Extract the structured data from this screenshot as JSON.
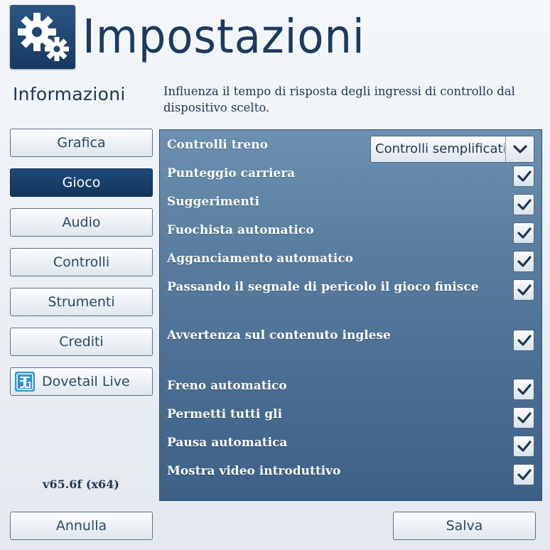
{
  "header": {
    "title": "Impostazioni",
    "icon": "gears-icon"
  },
  "sidebar": {
    "title": "Informazioni",
    "items": [
      {
        "label": "Grafica",
        "active": false
      },
      {
        "label": "Gioco",
        "active": true
      },
      {
        "label": "Audio",
        "active": false
      },
      {
        "label": "Controlli",
        "active": false
      },
      {
        "label": "Strumenti",
        "active": false
      },
      {
        "label": "Crediti",
        "active": false
      },
      {
        "label": "Dovetail Live",
        "active": false,
        "icon": "dovetail-live-icon"
      }
    ],
    "version": "v65.6f (x64)"
  },
  "description": "Influenza il tempo di risposta degli ingressi di controllo dal dispositivo scelto.",
  "settings": {
    "train_controls": {
      "label": "Controlli treno",
      "value": "Controlli semplificati"
    },
    "options": [
      {
        "label": "Punteggio carriera",
        "checked": true
      },
      {
        "label": "Suggerimenti",
        "checked": true
      },
      {
        "label": "Fuochista automatico",
        "checked": true
      },
      {
        "label": "Agganciamento automatico",
        "checked": true
      },
      {
        "label": "Passando il segnale di pericolo il gioco finisce",
        "checked": true
      },
      {
        "label": "Avvertenza sul contenuto inglese",
        "checked": true
      },
      {
        "label": "Freno automatico",
        "checked": true
      },
      {
        "label": "Permetti tutti gli",
        "checked": true
      },
      {
        "label": "Pausa automatica",
        "checked": true
      },
      {
        "label": "Mostra video introduttivo",
        "checked": true
      }
    ]
  },
  "footer": {
    "cancel_label": "Annulla",
    "save_label": "Salva"
  },
  "colors": {
    "accent": "#173a62",
    "panel": "#587c9e",
    "dovetail": "#2c95d6"
  }
}
